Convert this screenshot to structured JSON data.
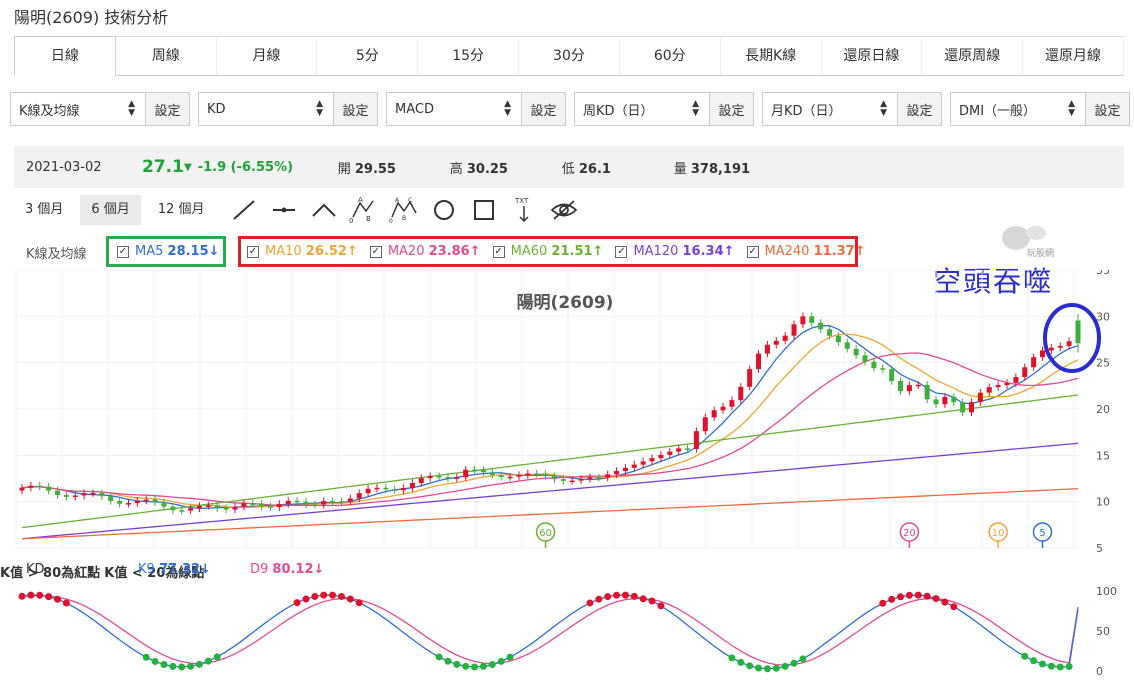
{
  "page": {
    "title": "陽明(2609) 技術分析"
  },
  "period_tabs": [
    {
      "label": "日線",
      "active": true
    },
    {
      "label": "周線"
    },
    {
      "label": "月線"
    },
    {
      "label": "5分"
    },
    {
      "label": "15分"
    },
    {
      "label": "30分"
    },
    {
      "label": "60分"
    },
    {
      "label": "長期K線"
    },
    {
      "label": "還原日線"
    },
    {
      "label": "還原周線"
    },
    {
      "label": "還原月線"
    }
  ],
  "indicators": [
    {
      "value": "K線及均線",
      "button": "設定"
    },
    {
      "value": "KD",
      "button": "設定"
    },
    {
      "value": "MACD",
      "button": "設定"
    },
    {
      "value": "周KD（日）",
      "button": "設定"
    },
    {
      "value": "月KD（日）",
      "button": "設定"
    },
    {
      "value": "DMI（一般）",
      "button": "設定"
    }
  ],
  "quote": {
    "date": "2021-03-02",
    "price": "27.1",
    "change": "-1.9 (-6.55%)",
    "open_label": "開",
    "open": "29.55",
    "high_label": "高",
    "high": "30.25",
    "low_label": "低",
    "low": "26.1",
    "volume_label": "量",
    "volume": "378,191"
  },
  "ranges": [
    {
      "label": "3 個月"
    },
    {
      "label": "6 個月",
      "active": true
    },
    {
      "label": "12 個月"
    }
  ],
  "tools": [
    "line-tool-icon",
    "horizontal-line-icon",
    "angle-tool-icon",
    "abc-pattern-icon",
    "abcd-pattern-icon",
    "circle-tool-icon",
    "rectangle-tool-icon",
    "text-tool-icon",
    "hide-icon"
  ],
  "tool_text": {
    "abc_a": "A",
    "abc_b": "B",
    "abc_0": "0",
    "abcd_a": "A",
    "abcd_c": "C",
    "abcd_b": "B",
    "abcd_0": "0",
    "txt": "TXT"
  },
  "ma_legend": {
    "label": "K線及均線",
    "ma5": {
      "name": "MA5",
      "value": "28.15↓",
      "color": "#2e6fd6"
    },
    "ma10": {
      "name": "MA10",
      "value": "26.52↑",
      "color": "#f2a531"
    },
    "ma20": {
      "name": "MA20",
      "value": "23.86↑",
      "color": "#e64b8f"
    },
    "ma60": {
      "name": "MA60",
      "value": "21.51↑",
      "color": "#6bb233"
    },
    "ma120": {
      "name": "MA120",
      "value": "16.34↑",
      "color": "#7a40d6"
    },
    "ma240": {
      "name": "MA240",
      "value": "11.37↑",
      "color": "#f06a3b"
    }
  },
  "watermark": "玩股網",
  "annotation": "空頭吞噬",
  "chart_data": [
    {
      "type": "candlestick",
      "title": "陽明(2609)",
      "y_ticks": [
        "35",
        "30",
        "25",
        "20",
        "15",
        "10",
        "5"
      ],
      "ylim": [
        5,
        35
      ],
      "markers": [
        {
          "label": "60",
          "color": "#6bb233"
        },
        {
          "label": "20",
          "color": "#e64b8f"
        },
        {
          "label": "10",
          "color": "#f2a531"
        },
        {
          "label": "5",
          "color": "#2e6fd6"
        }
      ],
      "last_close": 27.1,
      "last_open": 29.55,
      "last_high": 30.25,
      "last_low": 26.1
    },
    {
      "type": "line",
      "title": "KD",
      "series": [
        {
          "name": "K9",
          "value": "77.32↓",
          "color": "#2e6fd6"
        },
        {
          "name": "D9",
          "value": "80.12↓",
          "color": "#e64b8f"
        }
      ],
      "notes": [
        "K值 > 80為紅點",
        "K值 < 20為綠點"
      ],
      "y_ticks": [
        "100",
        "50",
        "0"
      ],
      "ylim": [
        0,
        100
      ]
    }
  ]
}
